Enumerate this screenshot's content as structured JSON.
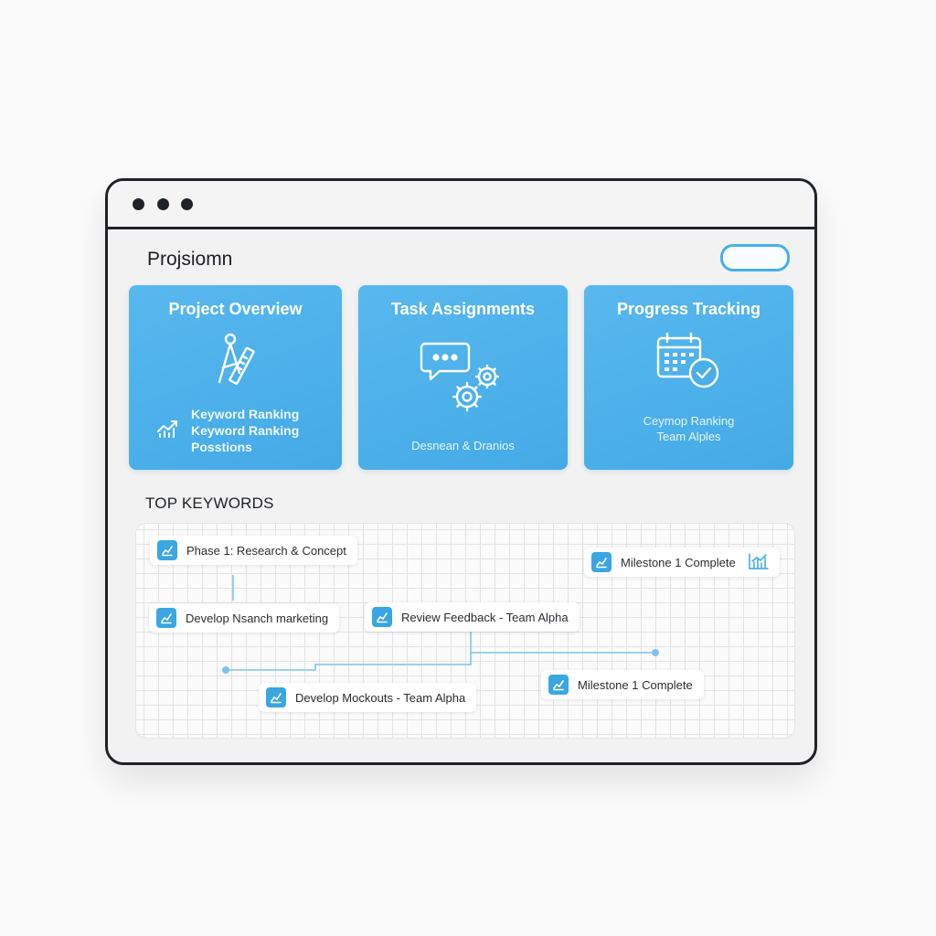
{
  "window": {
    "app_title": "Projsiomn"
  },
  "cards": [
    {
      "title": "Project Overview",
      "icon": "drafting-compass-icon",
      "lines": [
        "Keyword Ranking",
        "Keyword Ranking",
        "Posstions"
      ],
      "chart_icon": "trend-chart-icon"
    },
    {
      "title": "Task Assignments",
      "icon": "chat-gears-icon",
      "subtitle": "Desnean & Dranios"
    },
    {
      "title": "Progress Tracking",
      "icon": "calendar-check-icon",
      "lines": [
        "Ceymop Ranking",
        "Team Alples"
      ]
    }
  ],
  "keywords_section": {
    "title": "TOP KEYWORDS",
    "items": [
      {
        "label": "Phase 1: Research & Concept",
        "icon": "trend-chart-icon"
      },
      {
        "label": "Milestone 1 Complete",
        "icon": "trend-chart-icon",
        "trailing_icon": "bar-chart-icon"
      },
      {
        "label": "Develop Nsanch marketing",
        "icon": "trend-chart-icon"
      },
      {
        "label": "Review Feedback - Team Alpha",
        "icon": "trend-chart-icon"
      },
      {
        "label": "Develop Mockouts - Team Alpha",
        "icon": "trend-chart-icon"
      },
      {
        "label": "Milestone 1 Complete",
        "icon": "trend-chart-icon"
      }
    ]
  },
  "colors": {
    "accent": "#45b0e8",
    "card_bg": "#4eb1ea",
    "frame": "#1f2226",
    "connector": "#7cc4ee"
  }
}
